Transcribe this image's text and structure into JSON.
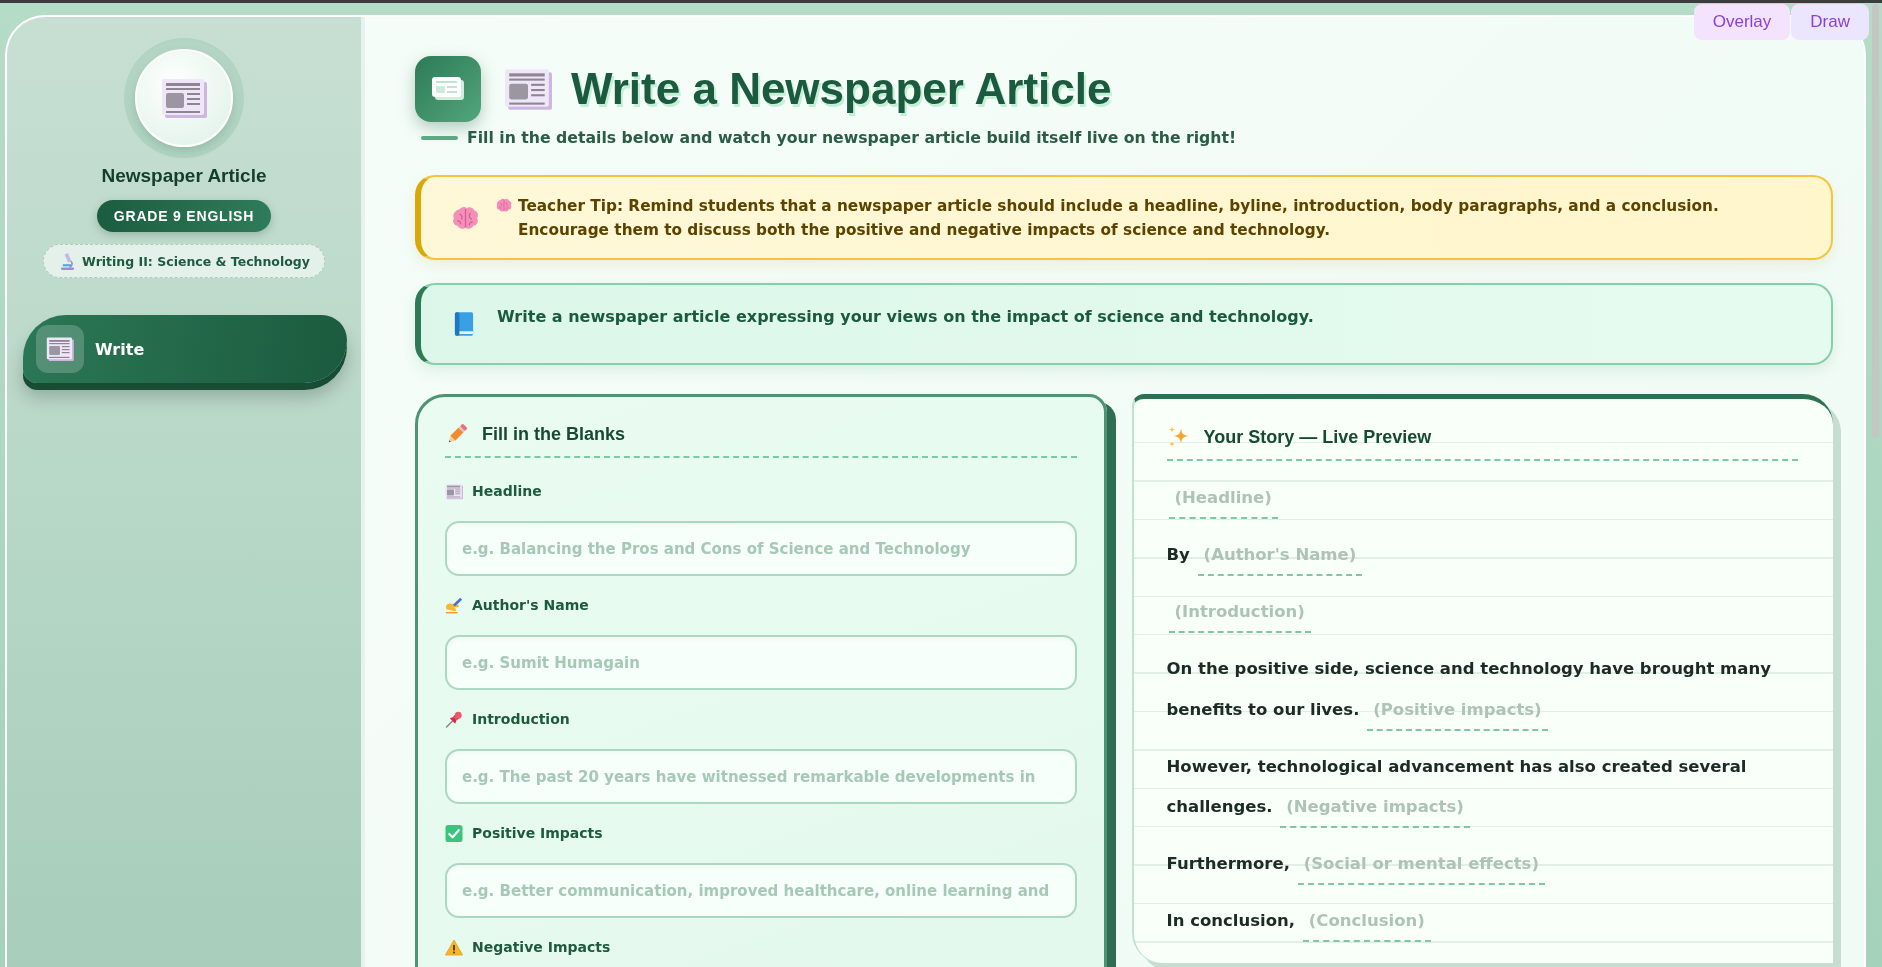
{
  "toolbar": {
    "buttons": [
      "Overlay",
      "Draw"
    ]
  },
  "sidebar": {
    "title": "Newspaper Article",
    "badge": "GRADE 9 ENGLISH",
    "topic": "Writing II: Science & Technology",
    "nav": [
      {
        "label": "Write",
        "selected": true
      }
    ]
  },
  "header": {
    "title": "Write a Newspaper Article",
    "subtitle": "Fill in the details below and watch your newspaper article build itself live on the right!"
  },
  "teacher_tip": {
    "text": "Teacher Tip: Remind students that a newspaper article should include a headline, byline, introduction, body paragraphs, and a conclusion. Encourage them to discuss both the positive and negative impacts of science and technology."
  },
  "task": {
    "text": "Write a newspaper article expressing your views on the impact of science and technology."
  },
  "form": {
    "title": "Fill in the Blanks",
    "fields": [
      {
        "label": "Headline",
        "placeholder": "e.g. Balancing the Pros and Cons of Science and Technology"
      },
      {
        "label": "Author's Name",
        "placeholder": "e.g. Sumit Humagain"
      },
      {
        "label": "Introduction",
        "placeholder": "e.g. The past 20 years have witnessed remarkable developments in"
      },
      {
        "label": "Positive Impacts",
        "placeholder": "e.g. Better communication, improved healthcare, online learning and"
      },
      {
        "label": "Negative Impacts"
      }
    ]
  },
  "preview": {
    "title": "Your Story — Live Preview",
    "lines": [
      {
        "blank": "(Headline)"
      },
      {
        "lead": "By",
        "blank": "(Author's Name)"
      },
      {
        "blank": "(Introduction)"
      },
      {
        "lead": "On the positive side, science and technology have brought many benefits to our lives.",
        "blank": "(Positive impacts)"
      },
      {
        "lead": "However, technological advancement has also created several challenges.",
        "blank": "(Negative impacts)"
      },
      {
        "lead": "Furthermore,",
        "blank": "(Social or mental effects)"
      },
      {
        "lead": "In conclusion,",
        "blank": "(Conclusion)"
      }
    ]
  }
}
